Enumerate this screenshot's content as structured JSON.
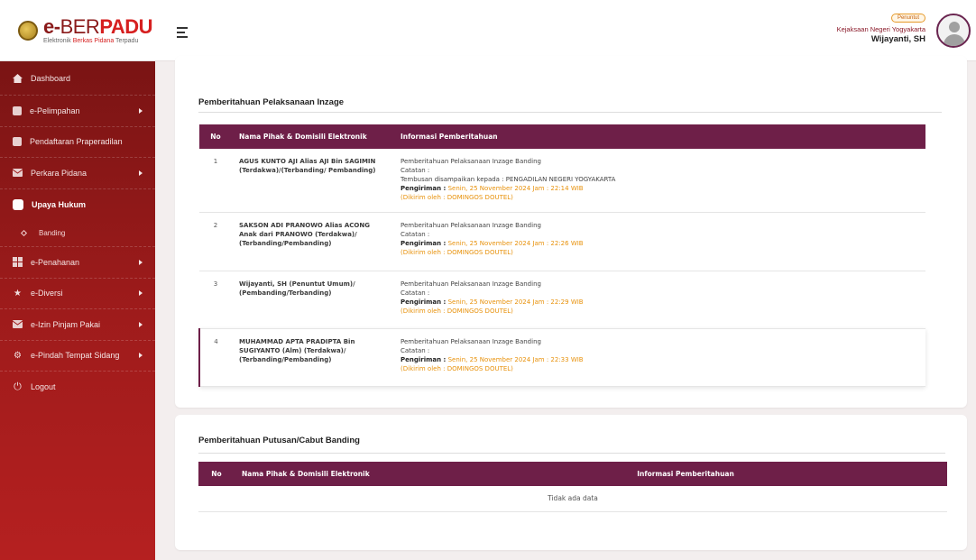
{
  "header": {
    "logo_e": "e-",
    "logo_ber": "BER",
    "logo_padu": "PADU",
    "logo_sub_1": "Elektronik",
    "logo_sub_2": "Berkas Pidana",
    "logo_sub_3": "Terpadu",
    "role": "Penuntut",
    "org": "Kejaksaan Negeri Yogyakarta",
    "user": "Wijayanti, SH"
  },
  "sidebar": {
    "items": [
      {
        "label": "Dashboard",
        "icon": "home-icon"
      },
      {
        "label": "e-Pelimpahan",
        "icon": "folder-icon"
      },
      {
        "label": "Pendaftaran Praperadilan",
        "icon": "folder-icon"
      },
      {
        "label": "Perkara Pidana",
        "icon": "mail-icon"
      },
      {
        "label": "Upaya Hukum",
        "icon": "folder-icon"
      },
      {
        "label": "Banding",
        "icon": "diamond-icon"
      },
      {
        "label": "e-Penahanan",
        "icon": "grid-icon"
      },
      {
        "label": "e-Diversi",
        "icon": "star-icon"
      },
      {
        "label": "e-Izin Pinjam Pakai",
        "icon": "mail-icon"
      },
      {
        "label": "e-Pindah Tempat Sidang",
        "icon": "gear-icon"
      },
      {
        "label": "Logout",
        "icon": "power-icon"
      }
    ]
  },
  "section1": {
    "title": "Pemberitahuan Pelaksanaan Inzage",
    "columns": [
      "No",
      "Nama Pihak & Domisili Elektronik",
      "Informasi Pemberitahuan"
    ],
    "rows": [
      {
        "no": "1",
        "party": "AGUS KUNTO AJI Alias AJI Bin SAGIMIN (Terdakwa)/(Terbanding/ Pembanding)",
        "title": "Pemberitahuan Pelaksanaan Inzage Banding",
        "catatan": "Catatan :",
        "tembusan": "Tembusan disampaikan kepada : PENGADILAN NEGERI YOGYAKARTA",
        "pengiriman_label": "Pengiriman :",
        "pengiriman": "Senin, 25 November 2024 Jam : 22:14 WIB",
        "dikirim": "(Dikirim oleh : DOMINGOS DOUTEL)"
      },
      {
        "no": "2",
        "party": "SAKSON ADI PRANOWO Alias ACONG Anak dari PRANOWO (Terdakwa)/ (Terbanding/Pembanding)",
        "title": "Pemberitahuan Pelaksanaan Inzage Banding",
        "catatan": "Catatan :",
        "tembusan": "",
        "pengiriman_label": "Pengiriman :",
        "pengiriman": "Senin, 25 November 2024 Jam : 22:26 WIB",
        "dikirim": "(Dikirim oleh : DOMINGOS DOUTEL)"
      },
      {
        "no": "3",
        "party": "Wijayanti, SH (Penuntut Umum)/ (Pembanding/Terbanding)",
        "title": "Pemberitahuan Pelaksanaan Inzage Banding",
        "catatan": "Catatan :",
        "tembusan": "",
        "pengiriman_label": "Pengiriman :",
        "pengiriman": "Senin, 25 November 2024 Jam : 22:29 WIB",
        "dikirim": "(Dikirim oleh : DOMINGOS DOUTEL)"
      },
      {
        "no": "4",
        "party": "MUHAMMAD APTA PRADIPTA Bin SUGIYANTO (Alm) (Terdakwa)/ (Terbanding/Pembanding)",
        "title": "Pemberitahuan Pelaksanaan Inzage Banding",
        "catatan": "Catatan :",
        "tembusan": "",
        "pengiriman_label": "Pengiriman :",
        "pengiriman": "Senin, 25 November 2024 Jam : 22:33 WIB",
        "dikirim": "(Dikirim oleh : DOMINGOS DOUTEL)"
      }
    ]
  },
  "section2": {
    "title": "Pemberitahuan Putusan/Cabut Banding",
    "columns": [
      "No",
      "Nama Pihak & Domisili Elektronik",
      "Informasi Pemberitahuan"
    ],
    "empty": "Tidak ada data"
  },
  "colors": {
    "header_purple": "#6e1f48",
    "sidebar_red": "#9e1b1b",
    "orange_text": "#e8920c"
  }
}
